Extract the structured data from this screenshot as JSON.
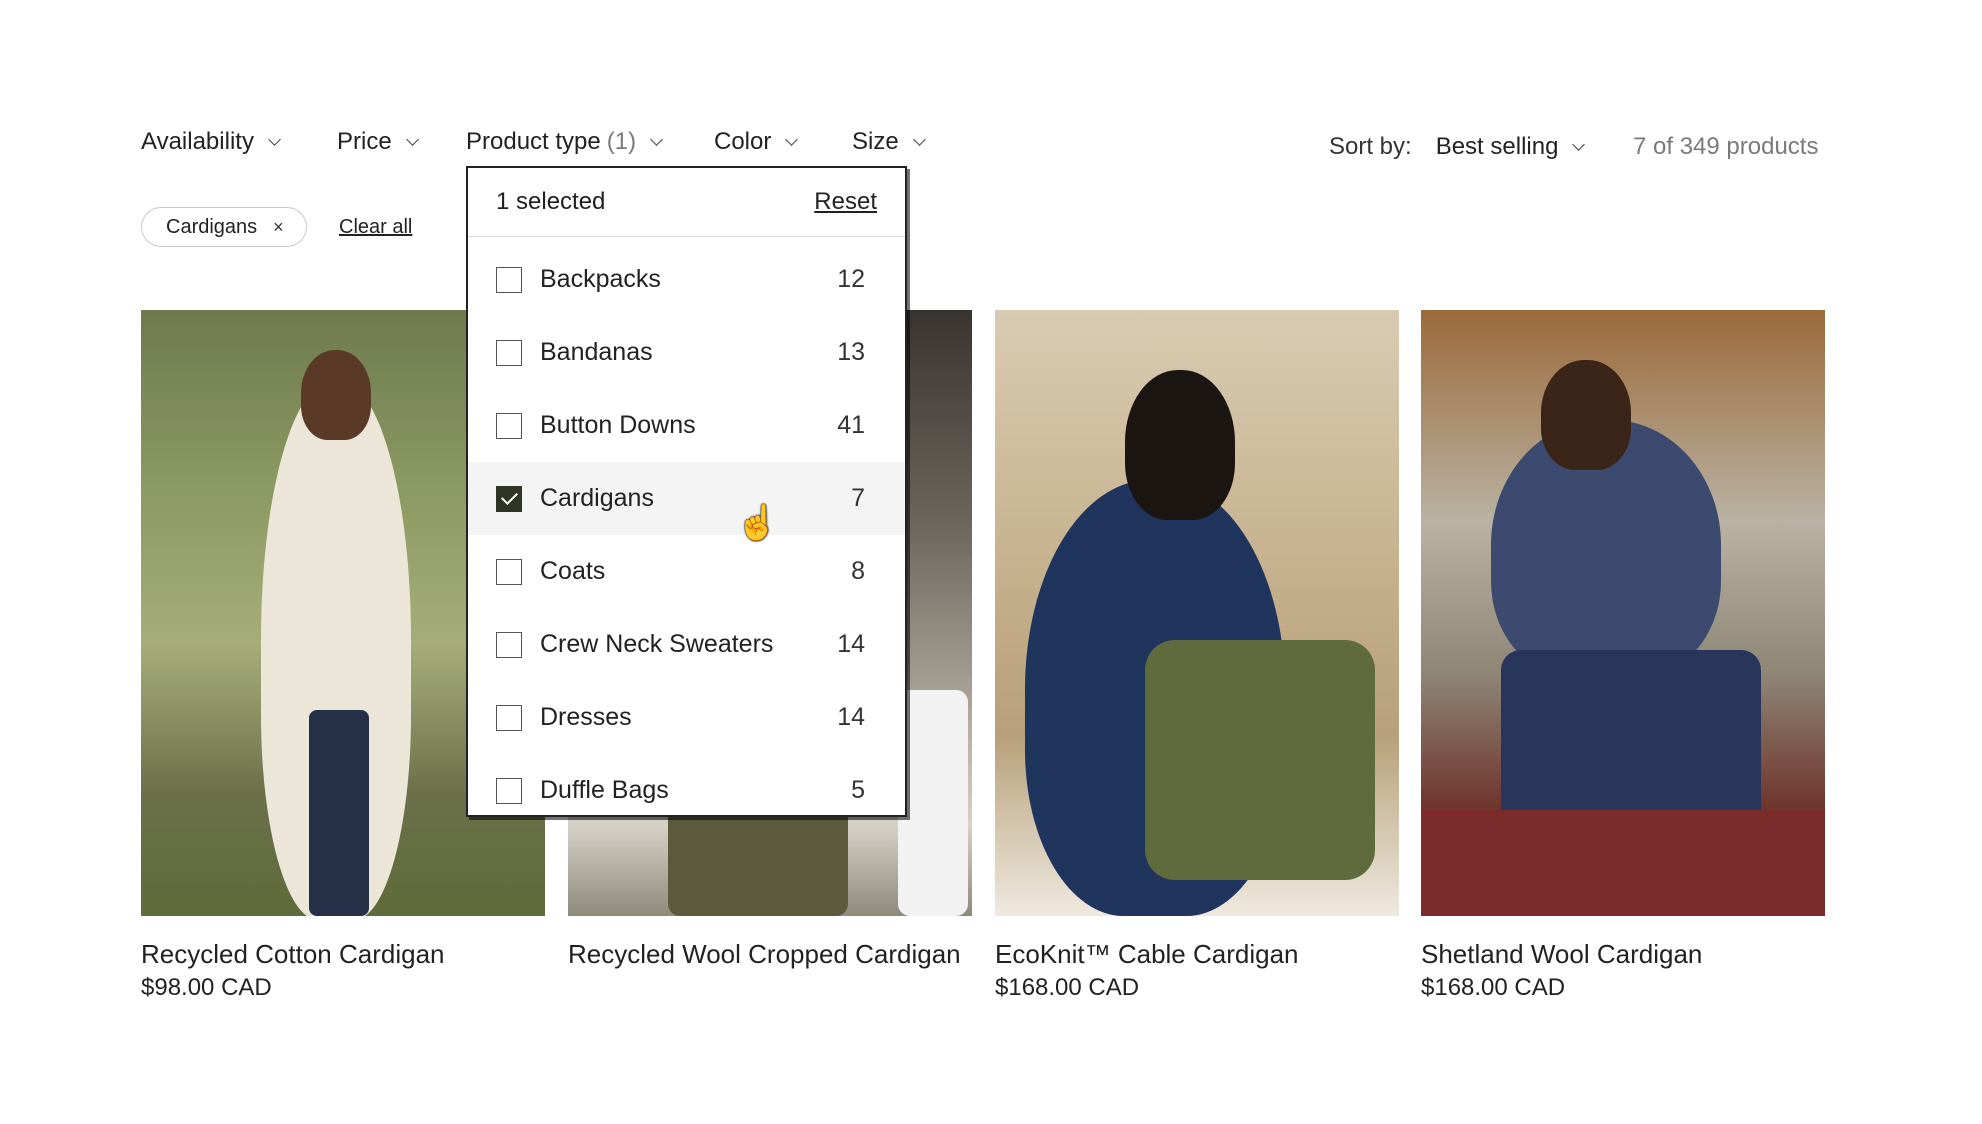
{
  "filters": {
    "availability": "Availability",
    "price": "Price",
    "product_type": "Product type",
    "product_type_count": "(1)",
    "color": "Color",
    "size": "Size"
  },
  "sort": {
    "label": "Sort by:",
    "value": "Best selling"
  },
  "product_count": "7 of 349 products",
  "active_filter": {
    "chip": "Cardigans",
    "remove": "×",
    "clear_all": "Clear all"
  },
  "dropdown": {
    "selected": "1 selected",
    "reset": "Reset",
    "options": [
      {
        "label": "Backpacks",
        "count": "12",
        "checked": false
      },
      {
        "label": "Bandanas",
        "count": "13",
        "checked": false
      },
      {
        "label": "Button Downs",
        "count": "41",
        "checked": false
      },
      {
        "label": "Cardigans",
        "count": "7",
        "checked": true
      },
      {
        "label": "Coats",
        "count": "8",
        "checked": false
      },
      {
        "label": "Crew Neck Sweaters",
        "count": "14",
        "checked": false
      },
      {
        "label": "Dresses",
        "count": "14",
        "checked": false
      },
      {
        "label": "Duffle Bags",
        "count": "5",
        "checked": false
      }
    ]
  },
  "products": [
    {
      "name": "Recycled Cotton Cardigan",
      "price": "$98.00 CAD"
    },
    {
      "name": "Recycled Wool Cropped Cardigan",
      "price": ""
    },
    {
      "name": "EcoKnit™ Cable Cardigan",
      "price": "$168.00 CAD"
    },
    {
      "name": "Shetland Wool Cardigan",
      "price": "$168.00 CAD"
    }
  ],
  "icons": {
    "chevron": "chevron-down-icon",
    "cursor": "pointer-hand-icon",
    "checkmark": "check-icon"
  }
}
